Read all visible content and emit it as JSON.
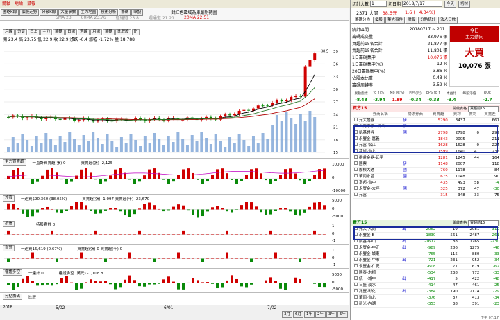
{
  "top": {
    "tabs": [
      "爾軸",
      "地給",
      "鼠報"
    ],
    "right_links": [
      "個股資訊",
      "交易機會",
      "社會題",
      "新聞測試"
    ]
  },
  "tabs2": [
    "圖略K線",
    "個股走勢",
    "分散K線",
    "大量參數",
    "主力地圖",
    "技術分析",
    "籌碼",
    "筆記"
  ],
  "title_chart": "封紅色區域為庫嚴附持圖",
  "ma": {
    "ma5": "5MA 23",
    "ma60": "60MA 23.76",
    "l1": "週通道 23.8",
    "l2": "週通道 21.21",
    "ma20": "20MA 22.51"
  },
  "period_buttons": [
    "月線",
    "分頁",
    "日上",
    "主力",
    "籌碼",
    "日線",
    "週線",
    "月線",
    "籌碼",
    "比較股",
    "比"
  ],
  "ohlc": "開 23.4 高 23.75 低 22.9 收 22.9 漲跌 -0.4 漲幅 -1.72% 量 18,788",
  "price_axis": [
    "39",
    "36",
    "33",
    "30",
    "27",
    "24",
    "21",
    "18",
    "15"
  ],
  "price_tag": "38.5",
  "panels": [
    {
      "name": "主力買賣超",
      "label": "一直計買賣超(張) 0",
      "label2": "買賣超(張) -2,125",
      "axis": [
        "10000",
        "0",
        "-10000"
      ]
    },
    {
      "name": "外資",
      "label": "一連買$90,360 (38.05%)",
      "label2": "買賣超(張) -1,097 買賣超(千) -23,670",
      "axis": [
        "5000",
        "0",
        "-5000"
      ]
    },
    {
      "name": "投信",
      "label": "",
      "label2": "持股賣數 0",
      "axis": [
        "1",
        "0",
        "-1"
      ]
    },
    {
      "name": "自營",
      "label": "一連買15,619 (0.67%)",
      "label2": "買賣超(張) 0 買賣超(千) 0",
      "axis": [
        "1",
        "0",
        "-1"
      ]
    },
    {
      "name": "權證多空",
      "label": "一連計 0",
      "label2": "權證多空 (萬元) -1,108.8",
      "axis": [
        "5000",
        "0",
        "-5000"
      ]
    },
    {
      "name": "分點籌碼",
      "label": "比較",
      "label2": "",
      "axis": []
    }
  ],
  "xdates": [
    "2018",
    "5/02",
    "6/01",
    "7/02"
  ],
  "range_buttons": [
    "3月",
    "6月",
    "1年",
    "2年",
    "3年",
    "5年"
  ],
  "right": {
    "label_count": "切計大數",
    "count_val": "1",
    "label_date": "切日期",
    "date_val": "2018/7/17",
    "today_btn": "今天",
    "analysis_btn": "切材",
    "stock": "2371 大同",
    "price": "38.5元",
    "change": "+1.6 (+4.34%)",
    "rtabs": [
      "籌碼分佈",
      "個股",
      "董大事件",
      "財報",
      "分點統計",
      "法人日數"
    ],
    "stats": [
      [
        "統計區間",
        "20180717 ~ 201.."
      ],
      [
        "籌碼成交量",
        "83,976 張"
      ],
      [
        "買超前15名合計",
        "21,877 張"
      ],
      [
        "賣超前15名合計",
        "-11,801 張"
      ],
      [
        "1日籌碼集中",
        "10,076 張"
      ],
      [
        "1日籌碼集中(%)",
        "12 %"
      ],
      [
        "20日籌碼集中(%)",
        "3.86 %"
      ],
      [
        "佔股本比重",
        "0.43 %"
      ],
      [
        "籌碼周轉率",
        "3.59 %"
      ]
    ],
    "today_title": "今日",
    "today_sub": "主力動向",
    "big_label": "大買",
    "big_val": "10,076 張",
    "metrics_head": [
      "異動指標",
      "Yo Y(%)",
      "Mo M(%)",
      "EPS(元)",
      "EPS Yo Y",
      "本益比",
      "每股淨值",
      "ROE"
    ],
    "metrics_val": [
      "-8.48",
      "-3.94",
      "1.89",
      "-0.34",
      "-0.33",
      "-3.4",
      "",
      "-2.7"
    ],
    "buy_title": "買方15",
    "sell_title": "賣方15",
    "more": "開啟表格",
    "select_val": "買超前15",
    "buy_head": [
      "券商名稱",
      "關係券商",
      "買賣超",
      "買均",
      "賣均",
      "買賣差"
    ],
    "buy_rows": [
      [
        "元大證券",
        "伊",
        "5290",
        "3437",
        "",
        "661"
      ],
      [
        "台灣摩根士丹利",
        "伊",
        "3571",
        "3703",
        "",
        "437"
      ],
      [
        "凱基證券",
        "國",
        "2798",
        "2798",
        "0",
        "292"
      ],
      [
        "永豐金-嘉義",
        "",
        "1843",
        "2005",
        "",
        "211"
      ],
      [
        "元富-松江",
        "",
        "1628",
        "1628",
        "0",
        "224"
      ],
      [
        "花旗-台北",
        "",
        "1599",
        "1640",
        "41",
        "235"
      ],
      [
        "群益金鼎-延平",
        "",
        "1281",
        "1245",
        "44",
        "164"
      ],
      [
        "國票",
        "伊",
        "1148",
        "2007",
        "",
        "118"
      ],
      [
        "摩根大通",
        "國",
        "760",
        "1178",
        "",
        "84"
      ],
      [
        "華南永昌",
        "國",
        "675",
        "1048",
        "",
        "90"
      ],
      [
        "富邦-台中",
        "",
        "435",
        "493",
        "58",
        "-4"
      ],
      [
        "永豐金-大坪",
        "國",
        "325",
        "372",
        "47",
        "-30"
      ],
      [
        "元富",
        "",
        "315",
        "348",
        "33",
        "75"
      ]
    ],
    "sell_rows": [
      [
        "元大-大同",
        "出",
        "-2062",
        "19",
        "2081",
        "-310"
      ],
      [
        "永豐金-B",
        "",
        "-1830",
        "561",
        "2487",
        "-261"
      ],
      [
        "凱基-中山",
        "出",
        "-1677",
        "88",
        "1765",
        "-230"
      ],
      [
        "永豐金-中正",
        "出",
        "-989",
        "286",
        "1275",
        "-46"
      ],
      [
        "永豐金-城東",
        "",
        "-765",
        "115",
        "880",
        "-33"
      ],
      [
        "永豐金-中市",
        "出",
        "-721",
        "231",
        "952",
        "-34"
      ],
      [
        "永豐金-仁愛",
        "",
        "-608",
        "71",
        "679",
        "-62"
      ],
      [
        "國泰-木柵",
        "",
        "-534",
        "238",
        "772",
        "-33"
      ],
      [
        "統一-城中",
        "出",
        "-417",
        "5",
        "422",
        "-48"
      ],
      [
        "日盛-淡水",
        "",
        "-414",
        "47",
        "461",
        "-25"
      ],
      [
        "兆豐-彰化",
        "出",
        "-384",
        "1790",
        "2174",
        "-29"
      ],
      [
        "華南-台北",
        "",
        "-376",
        "37",
        "413",
        "-34"
      ],
      [
        "新光-內湖",
        "",
        "-353",
        "38",
        "391",
        "-23"
      ]
    ],
    "status": "下午 07:17"
  },
  "colors": {
    "up": "#d00000",
    "down": "#0a8a0a",
    "vol": "#7aa3d6",
    "accent": "#c00000",
    "box": "#1a2c9c"
  }
}
